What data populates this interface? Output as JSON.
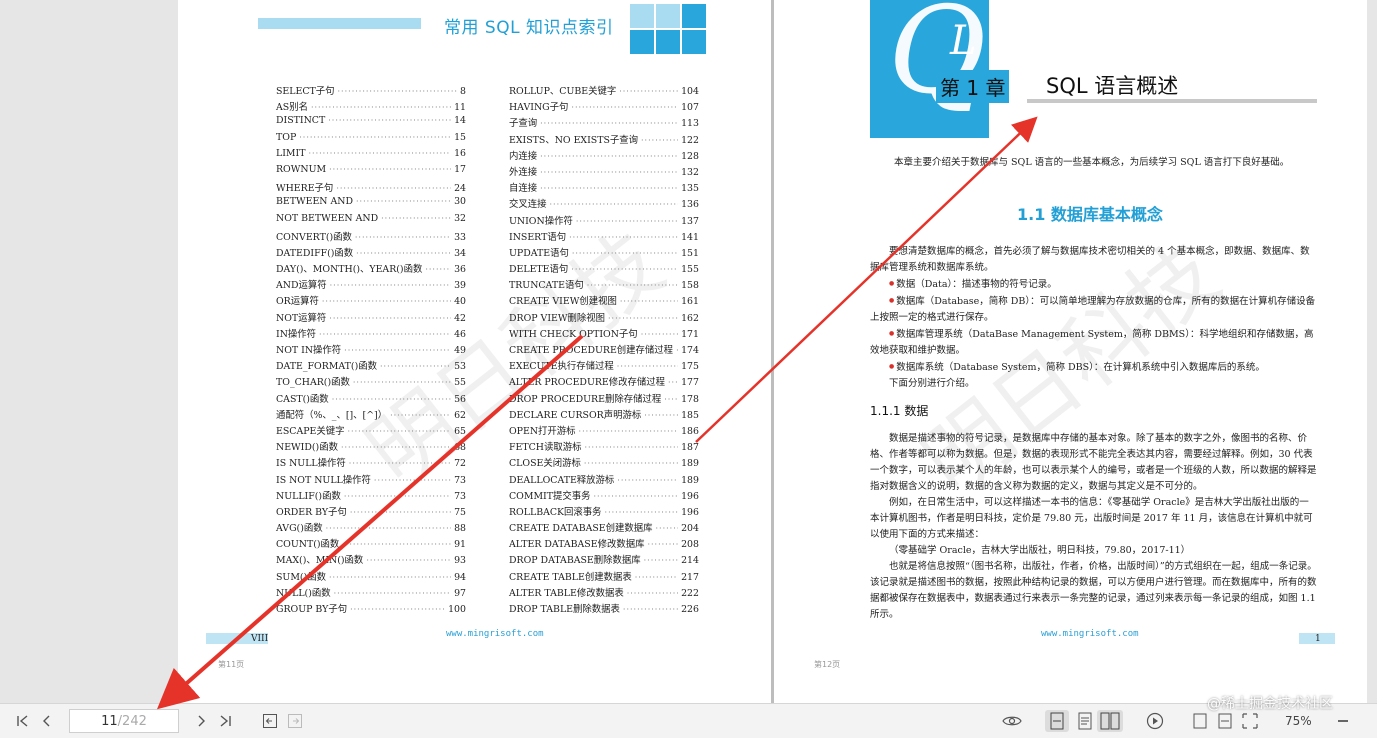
{
  "left_page": {
    "header_title": "常用 SQL 知识点索引",
    "toc_left": [
      {
        "t": "SELECT子句",
        "p": "8"
      },
      {
        "t": "AS别名",
        "p": "11"
      },
      {
        "t": "DISTINCT",
        "p": "14"
      },
      {
        "t": "TOP",
        "p": "15"
      },
      {
        "t": "LIMIT",
        "p": "16"
      },
      {
        "t": "ROWNUM",
        "p": "17"
      },
      {
        "t": "WHERE子句",
        "p": "24"
      },
      {
        "t": "BETWEEN AND",
        "p": "30"
      },
      {
        "t": "NOT BETWEEN AND",
        "p": "32"
      },
      {
        "t": "CONVERT()函数",
        "p": "33"
      },
      {
        "t": "DATEDIFF()函数",
        "p": "34"
      },
      {
        "t": "DAY()、MONTH()、YEAR()函数",
        "p": "36"
      },
      {
        "t": "AND运算符",
        "p": "39"
      },
      {
        "t": "OR运算符",
        "p": "40"
      },
      {
        "t": "NOT运算符",
        "p": "42"
      },
      {
        "t": "IN操作符",
        "p": "46"
      },
      {
        "t": "NOT IN操作符",
        "p": "49"
      },
      {
        "t": "DATE_FORMAT()函数",
        "p": "53"
      },
      {
        "t": "TO_CHAR()函数",
        "p": "55"
      },
      {
        "t": "CAST()函数",
        "p": "56"
      },
      {
        "t": "通配符（%、_、[]、[^]）",
        "p": "62"
      },
      {
        "t": "ESCAPE关键字",
        "p": "65"
      },
      {
        "t": "NEWID()函数",
        "p": "68"
      },
      {
        "t": "IS NULL操作符",
        "p": "72"
      },
      {
        "t": "IS NOT NULL操作符",
        "p": "73"
      },
      {
        "t": "NULLIF()函数",
        "p": "73"
      },
      {
        "t": "ORDER BY子句",
        "p": "75"
      },
      {
        "t": "AVG()函数",
        "p": "88"
      },
      {
        "t": "COUNT()函数",
        "p": "91"
      },
      {
        "t": "MAX()、MIN()函数",
        "p": "93"
      },
      {
        "t": "SUM()函数",
        "p": "94"
      },
      {
        "t": "NULL()函数",
        "p": "97"
      },
      {
        "t": "GROUP BY子句",
        "p": "100"
      }
    ],
    "toc_right": [
      {
        "t": "ROLLUP、CUBE关键字",
        "p": "104"
      },
      {
        "t": "HAVING子句",
        "p": "107"
      },
      {
        "t": "子查询",
        "p": "113"
      },
      {
        "t": "EXISTS、NO EXISTS子查询",
        "p": "122"
      },
      {
        "t": "内连接",
        "p": "128"
      },
      {
        "t": "外连接",
        "p": "132"
      },
      {
        "t": "自连接",
        "p": "135"
      },
      {
        "t": "交叉连接",
        "p": "136"
      },
      {
        "t": "UNION操作符",
        "p": "137"
      },
      {
        "t": "INSERT语句",
        "p": "141"
      },
      {
        "t": "UPDATE语句",
        "p": "151"
      },
      {
        "t": "DELETE语句",
        "p": "155"
      },
      {
        "t": "TRUNCATE语句",
        "p": "158"
      },
      {
        "t": "CREATE VIEW创建视图",
        "p": "161"
      },
      {
        "t": "DROP VIEW删除视图",
        "p": "162"
      },
      {
        "t": "WITH CHECK OPTION子句",
        "p": "171"
      },
      {
        "t": "CREATE PROCEDURE创建存储过程",
        "p": "174"
      },
      {
        "t": "EXECUTE执行存储过程",
        "p": "175"
      },
      {
        "t": "ALTER PROCEDURE修改存储过程",
        "p": "177"
      },
      {
        "t": "DROP PROCEDURE删除存储过程",
        "p": "178"
      },
      {
        "t": "DECLARE CURSOR声明游标",
        "p": "185"
      },
      {
        "t": "OPEN打开游标",
        "p": "186"
      },
      {
        "t": "FETCH读取游标",
        "p": "187"
      },
      {
        "t": "CLOSE关闭游标",
        "p": "189"
      },
      {
        "t": "DEALLOCATE释放游标",
        "p": "189"
      },
      {
        "t": "COMMIT提交事务",
        "p": "196"
      },
      {
        "t": "ROLLBACK回滚事务",
        "p": "196"
      },
      {
        "t": "CREATE DATABASE创建数据库",
        "p": "204"
      },
      {
        "t": "ALTER DATABASE修改数据库",
        "p": "208"
      },
      {
        "t": "DROP DATABASE删除数据库",
        "p": "214"
      },
      {
        "t": "CREATE TABLE创建数据表",
        "p": "217"
      },
      {
        "t": "ALTER TABLE修改数据表",
        "p": "222"
      },
      {
        "t": "DROP TABLE删除数据表",
        "p": "226"
      }
    ],
    "folio": "VIII",
    "site": "www.mingrisoft.com",
    "page_label": "第11页"
  },
  "right_page": {
    "chapter_letters_q": "Q",
    "chapter_letters_l": "L",
    "chapter_label": "第 1 章",
    "chapter_title": "SQL 语言概述",
    "intro": "本章主要介绍关于数据库与 SQL 语言的一些基本概念，为后续学习 SQL 语言打下良好基础。",
    "section_title": "1.1  数据库基本概念",
    "para1": "要想清楚数据库的概念，首先必须了解与数据库技术密切相关的 4 个基本概念，即数据、数据库、数据库管理系统和数据库系统。",
    "bullet1": "数据（Data）：描述事物的符号记录。",
    "bullet2": "数据库（Database，简称 DB）：可以简单地理解为存放数据的仓库，所有的数据在计算机存储设备上按照一定的格式进行保存。",
    "bullet3": "数据库管理系统（DataBase Management System，简称 DBMS）：科学地组织和存储数据，高效地获取和维护数据。",
    "bullet4": "数据库系统（Database System，简称 DBS）：在计算机系统中引入数据库后的系统。",
    "para2": "下面分别进行介绍。",
    "subsection_title": "1.1.1  数据",
    "para3": "数据是描述事物的符号记录，是数据库中存储的基本对象。除了基本的数字之外，像图书的名称、价格、作者等都可以称为数据。但是，数据的表现形式不能完全表达其内容，需要经过解释。例如，30 代表一个数字，可以表示某个人的年龄，也可以表示某个人的编号，或者是一个班级的人数，所以数据的解释是指对数据含义的说明，数据的含义称为数据的定义，数据与其定义是不可分的。",
    "para4": "例如，在日常生活中，可以这样描述一本书的信息：《零基础学 Oracle》是吉林大学出版社出版的一本计算机图书，作者是明日科技，定价是 79.80 元，出版时间是 2017 年 11 月，该信息在计算机中就可以使用下面的方式来描述：",
    "para5": "（零基础学 Oracle，吉林大学出版社，明日科技，79.80，2017-11）",
    "para6": "也就是将信息按照“（图书名称，出版社，作者，价格，出版时间）”的方式组织在一起，组成一条记录。该记录就是描述图书的数据，按照此种结构记录的数据，可以方便用户进行管理。而在数据库中，所有的数据都被保存在数据表中，数据表通过行来表示一条完整的记录，通过列来表示每一条记录的组成，如图 1.1 所示。",
    "folio": "1",
    "site": "www.mingrisoft.com",
    "page_label": "第12页"
  },
  "watermarks": [
    "明日科技",
    "明日科技"
  ],
  "toolbar": {
    "current_page": "11",
    "total_pages": "/242",
    "zoom": "75%",
    "brand": "@稀土掘金技术社区",
    "icons": [
      "first-page-icon",
      "prev-page-icon",
      "next-page-icon",
      "last-page-icon",
      "back-icon",
      "forward-icon",
      "eye-icon",
      "single-page-icon",
      "continuous-icon",
      "two-page-icon",
      "play-icon",
      "fit-page-icon",
      "fit-width-icon",
      "zoom-out-icon"
    ]
  },
  "colors": {
    "accent": "#29a6dc",
    "accent_light": "#a9dcf1",
    "arrow": "#e5332a"
  }
}
